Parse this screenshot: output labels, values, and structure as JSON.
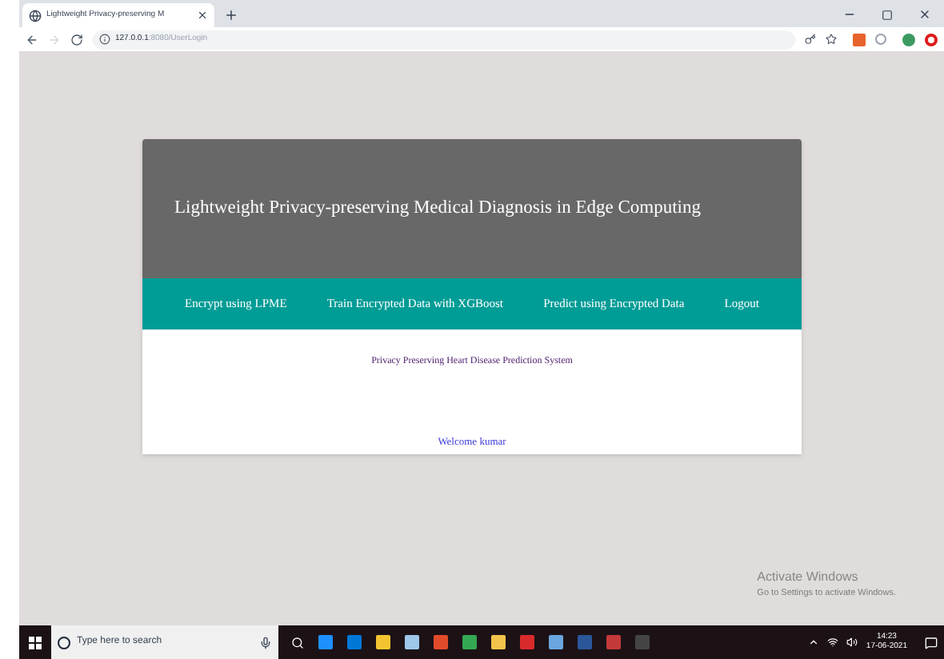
{
  "browser": {
    "tab_title": "Lightweight Privacy-preserving M",
    "url_host": "127.0.0.1",
    "url_path": ":8080/UserLogin"
  },
  "page": {
    "title": "Lightweight Privacy-preserving Medical Diagnosis in Edge Computing",
    "nav": [
      {
        "label": "Encrypt using LPME"
      },
      {
        "label": "Train Encrypted Data with XGBoost"
      },
      {
        "label": "Predict using Encrypted Data"
      },
      {
        "label": "Logout"
      }
    ],
    "subtitle": "Privacy Preserving Heart Disease Prediction System",
    "welcome": "Welcome kumar"
  },
  "activation": {
    "title": "Activate Windows",
    "hint": "Go to Settings to activate Windows."
  },
  "taskbar": {
    "search_placeholder": "Type here to search",
    "apps": [
      {
        "color": "#1e90ff"
      },
      {
        "color": "#0078d7"
      },
      {
        "color": "#f4c430"
      },
      {
        "color": "#9ec7e8"
      },
      {
        "color": "#e24b2a"
      },
      {
        "color": "#34a853"
      },
      {
        "color": "#f3c44b"
      },
      {
        "color": "#d92b2b"
      },
      {
        "color": "#6aa6e0"
      },
      {
        "color": "#2b579a"
      },
      {
        "color": "#c43a3a"
      },
      {
        "color": "#444444"
      }
    ],
    "time": "14:23",
    "date": "17-06-2021"
  }
}
